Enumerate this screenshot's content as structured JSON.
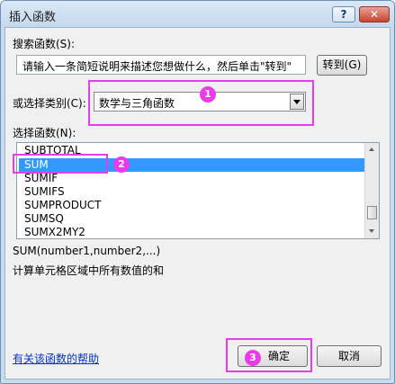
{
  "window": {
    "title": "插入函数",
    "help_glyph": "?",
    "close_glyph": "✕"
  },
  "search": {
    "label": "搜索函数(S):",
    "value": "请输入一条简短说明来描述您想做什么，然后单击\"转到\"",
    "goto_button": "转到(G)"
  },
  "category": {
    "label": "或选择类别(C):",
    "selected": "数学与三角函数"
  },
  "function_list": {
    "label": "选择函数(N):",
    "items": [
      "SUBTOTAL",
      "SUM",
      "SUMIF",
      "SUMIFS",
      "SUMPRODUCT",
      "SUMSQ",
      "SUMX2MY2"
    ],
    "selected": "SUM"
  },
  "selected_function": {
    "syntax": "SUM(number1,number2,...)",
    "description": "计算单元格区域中所有数值的和"
  },
  "footer": {
    "help_link": "有关该函数的帮助",
    "ok_button": "确定",
    "cancel_button": "取消"
  },
  "annotations": {
    "marker_1": "1",
    "marker_2": "2",
    "marker_3": "3",
    "color": "#e040e6"
  }
}
